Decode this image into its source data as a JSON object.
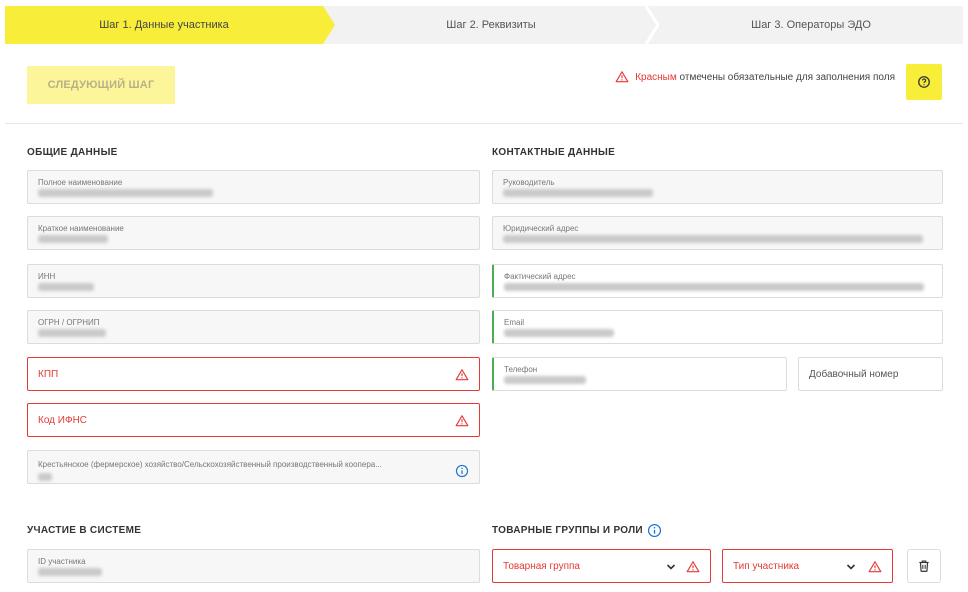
{
  "steps": [
    {
      "label": "Шаг 1. Данные участника",
      "active": true
    },
    {
      "label": "Шаг 2. Реквизиты",
      "active": false
    },
    {
      "label": "Шаг 3. Операторы ЭДО",
      "active": false
    }
  ],
  "header": {
    "next_label": "СЛЕДУЮЩИЙ ШАГ",
    "hint_red": "Красным",
    "hint_rest": "отмечены обязательные для заполнения поля"
  },
  "general": {
    "title": "ОБЩИЕ ДАННЫЕ",
    "full_name_label": "Полное наименование",
    "short_name_label": "Краткое наименование",
    "inn_label": "ИНН",
    "ogrn_label": "ОГРН / ОГРНИП",
    "kpp_label": "КПП",
    "ifns_label": "Код ИФНС",
    "farm_label": "Крестьянское (фермерское) хозяйство/Сельскохозяйственный производственный коопера..."
  },
  "contacts": {
    "title": "КОНТАКТНЫЕ ДАННЫЕ",
    "head_label": "Руководитель",
    "legal_address_label": "Юридический адрес",
    "actual_address_label": "Фактический адрес",
    "email_label": "Email",
    "phone_label": "Телефон",
    "ext_placeholder": "Добавочный номер"
  },
  "participation": {
    "title": "УЧАСТИЕ В СИСТЕМЕ",
    "id_label": "ID участника"
  },
  "groups": {
    "title": "ТОВАРНЫЕ ГРУППЫ И РОЛИ",
    "group_placeholder": "Товарная группа",
    "type_placeholder": "Тип участника"
  },
  "colors": {
    "accent": "#f8ee3a",
    "required": "#e53935",
    "valid": "#4caf50",
    "info": "#1976d2"
  }
}
